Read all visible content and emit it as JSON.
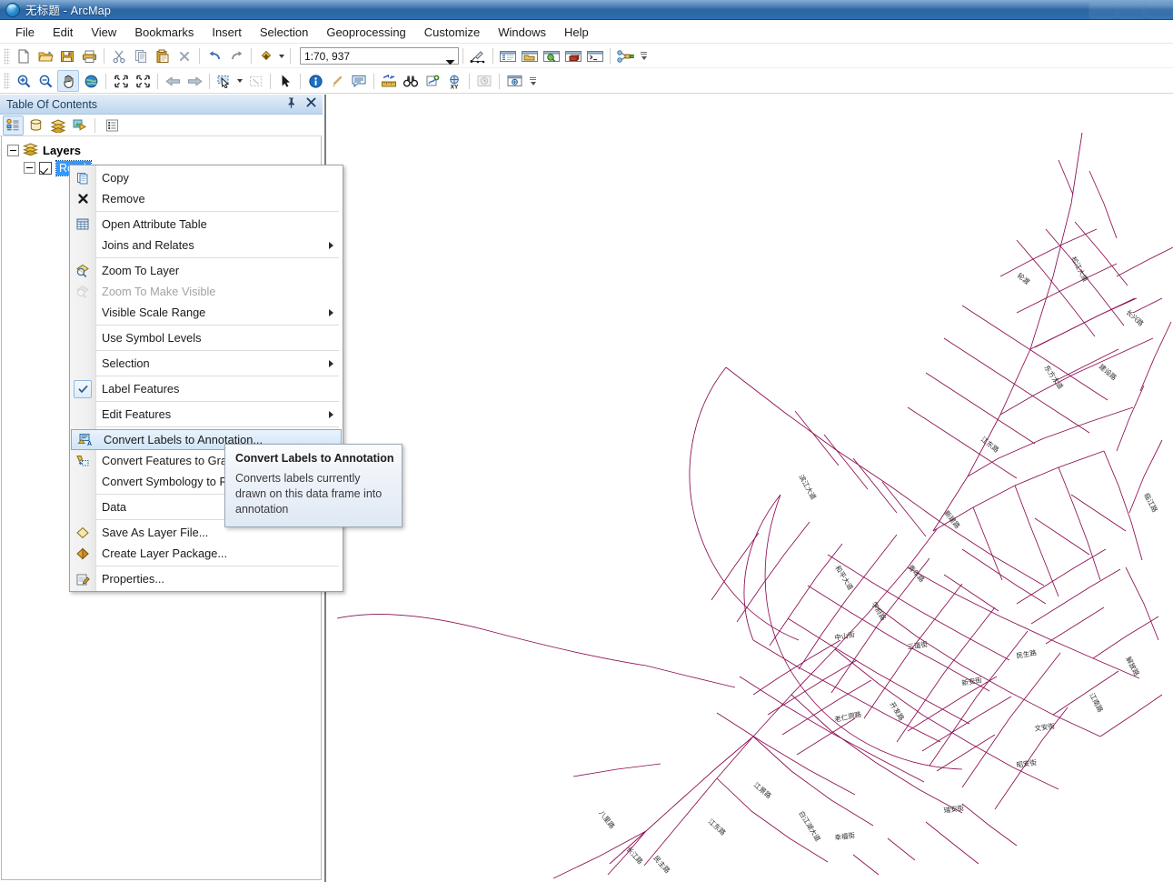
{
  "window": {
    "title": "无标题 - ArcMap",
    "logo_icon": "arcmap-globe-icon",
    "minimize_label": "",
    "maximize_label": "",
    "close_label": ""
  },
  "menubar": {
    "items": [
      {
        "label": "File",
        "name": "menu-file"
      },
      {
        "label": "Edit",
        "name": "menu-edit"
      },
      {
        "label": "View",
        "name": "menu-view"
      },
      {
        "label": "Bookmarks",
        "name": "menu-bookmarks"
      },
      {
        "label": "Insert",
        "name": "menu-insert"
      },
      {
        "label": "Selection",
        "name": "menu-selection"
      },
      {
        "label": "Geoprocessing",
        "name": "menu-geoprocessing"
      },
      {
        "label": "Customize",
        "name": "menu-customize"
      },
      {
        "label": "Windows",
        "name": "menu-windows"
      },
      {
        "label": "Help",
        "name": "menu-help"
      }
    ]
  },
  "standard_toolbar": {
    "buttons": [
      "new-document-icon",
      "open-folder-icon",
      "save-icon",
      "print-icon",
      "cut-scissors-icon",
      "copy-icon",
      "paste-icon",
      "delete-x-icon",
      "undo-arrow-icon",
      "redo-arrow-icon",
      "add-data-icon"
    ],
    "scale": {
      "value": "1:70, 937",
      "placeholder": "1:70, 937"
    },
    "right_buttons": [
      "editor-toolbar-icon",
      "table-of-contents-icon",
      "catalog-window-icon",
      "search-window-icon",
      "arctoolbox-icon",
      "python-window-icon",
      "model-builder-icon"
    ]
  },
  "tools_toolbar": {
    "buttons": [
      "zoom-in-icon",
      "zoom-out-icon",
      "pan-hand-icon",
      "full-extent-globe-icon",
      "fixed-zoom-in-icon",
      "fixed-zoom-out-icon",
      "go-back-extent-icon",
      "go-forward-extent-icon",
      "select-features-icon",
      "clear-selection-icon",
      "select-elements-arrow-icon",
      "identify-icon",
      "hyperlink-icon",
      "html-popup-icon",
      "measure-icon",
      "find-binoculars-icon",
      "find-route-icon",
      "go-to-xy-icon",
      "time-slider-icon",
      "create-viewer-window-icon"
    ],
    "active_button": "pan-hand-icon"
  },
  "toc": {
    "title": "Table Of Contents",
    "pin_icon": "pin-icon",
    "close_icon": "close-icon",
    "tabs": [
      {
        "name": "list-by-drawing-order",
        "icon": "list-by-drawing-order-icon",
        "active": true
      },
      {
        "name": "list-by-source",
        "icon": "list-by-source-icon",
        "active": false
      },
      {
        "name": "list-by-visibility",
        "icon": "list-by-visibility-icon",
        "active": false
      },
      {
        "name": "list-by-selection",
        "icon": "list-by-selection-icon",
        "active": false
      },
      {
        "name": "options",
        "icon": "toc-options-icon",
        "active": false
      }
    ],
    "tree": {
      "root_label": "Layers",
      "root_icon": "data-frame-layers-icon",
      "child_label": "Road",
      "child_checked": true,
      "child_selected": true
    }
  },
  "context_menu": {
    "items": [
      {
        "label": "Copy",
        "icon": "copy-icon",
        "name": "ctx-copy",
        "submenu": false,
        "disabled": false,
        "checked": false
      },
      {
        "label": "Remove",
        "icon": "remove-x-icon",
        "name": "ctx-remove",
        "submenu": false,
        "disabled": false,
        "checked": false
      },
      {
        "separator": true
      },
      {
        "label": "Open Attribute Table",
        "icon": "attribute-table-icon",
        "name": "ctx-open-attribute-table",
        "submenu": false,
        "disabled": false,
        "checked": false
      },
      {
        "label": "Joins and Relates",
        "icon": "",
        "name": "ctx-joins-and-relates",
        "submenu": true,
        "disabled": false,
        "checked": false
      },
      {
        "separator": true
      },
      {
        "label": "Zoom To Layer",
        "icon": "zoom-to-layer-icon",
        "name": "ctx-zoom-to-layer",
        "submenu": false,
        "disabled": false,
        "checked": false
      },
      {
        "label": "Zoom To Make Visible",
        "icon": "zoom-to-make-visible-icon",
        "name": "ctx-zoom-to-make-visible",
        "submenu": false,
        "disabled": true,
        "checked": false
      },
      {
        "label": "Visible Scale Range",
        "icon": "",
        "name": "ctx-visible-scale-range",
        "submenu": true,
        "disabled": false,
        "checked": false
      },
      {
        "separator": true
      },
      {
        "label": "Use Symbol Levels",
        "icon": "",
        "name": "ctx-use-symbol-levels",
        "submenu": false,
        "disabled": false,
        "checked": false
      },
      {
        "separator": true
      },
      {
        "label": "Selection",
        "icon": "",
        "name": "ctx-selection",
        "submenu": true,
        "disabled": false,
        "checked": false
      },
      {
        "separator": true
      },
      {
        "label": "Label Features",
        "icon": "checkbox-checked-icon",
        "name": "ctx-label-features",
        "submenu": false,
        "disabled": false,
        "checked": true
      },
      {
        "separator": true
      },
      {
        "label": "Edit Features",
        "icon": "",
        "name": "ctx-edit-features",
        "submenu": true,
        "disabled": false,
        "checked": false
      },
      {
        "separator": true
      },
      {
        "label": "Convert Labels to Annotation...",
        "icon": "convert-labels-to-annotation-icon",
        "name": "ctx-convert-labels-to-annotation",
        "submenu": false,
        "disabled": false,
        "checked": false,
        "selected": true
      },
      {
        "label": "Convert Features to Graphics...",
        "icon": "convert-features-to-graphics-icon",
        "name": "ctx-convert-features-to-graphics",
        "submenu": false,
        "disabled": false,
        "checked": false
      },
      {
        "label": "Convert Symbology to Representation...",
        "icon": "",
        "name": "ctx-convert-symbology-to-representation",
        "submenu": false,
        "disabled": false,
        "checked": false
      },
      {
        "separator": true
      },
      {
        "label": "Data",
        "icon": "",
        "name": "ctx-data",
        "submenu": true,
        "disabled": false,
        "checked": false
      },
      {
        "separator": true
      },
      {
        "label": "Save As Layer File...",
        "icon": "layer-file-icon",
        "name": "ctx-save-as-layer-file",
        "submenu": false,
        "disabled": false,
        "checked": false
      },
      {
        "label": "Create Layer Package...",
        "icon": "layer-package-icon",
        "name": "ctx-create-layer-package",
        "submenu": false,
        "disabled": false,
        "checked": false
      },
      {
        "separator": true
      },
      {
        "label": "Properties...",
        "icon": "properties-icon",
        "name": "ctx-properties",
        "submenu": false,
        "disabled": false,
        "checked": false
      }
    ]
  },
  "tooltip": {
    "title": "Convert Labels to Annotation",
    "body": "Converts labels currently drawn on this data frame into annotation"
  },
  "map": {
    "line_color": "#8b0a50",
    "label_color": "#2b2b2b",
    "background": "#ffffff",
    "street_labels": [
      "松江大道",
      "轮渡",
      "江南路",
      "东方大道",
      "江东路",
      "民生路",
      "三道街",
      "文安街",
      "昭安街",
      "瑞安街",
      "江景路",
      "八里路",
      "长江路",
      "白江湖大道",
      "滨江大道",
      "新建路",
      "青年路",
      "和平路",
      "开发路",
      "幸福街",
      "建设路"
    ]
  }
}
